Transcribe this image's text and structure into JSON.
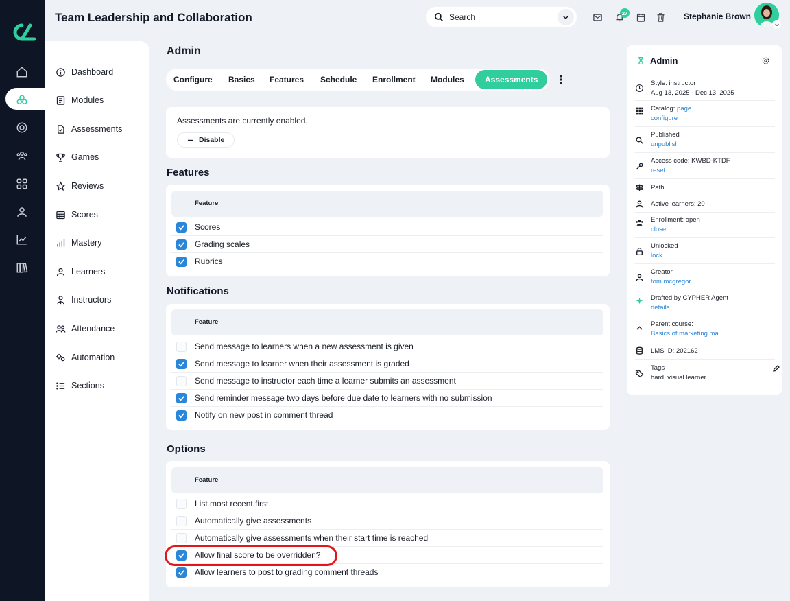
{
  "header": {
    "title": "Team Leadership and Collaboration",
    "search_placeholder": "Search",
    "notifications_count": "27",
    "user_name": "Stephanie Brown"
  },
  "nav": {
    "items": [
      {
        "label": "Dashboard",
        "icon": "info-icon"
      },
      {
        "label": "Modules",
        "icon": "document-icon"
      },
      {
        "label": "Assessments",
        "icon": "checklist-icon"
      },
      {
        "label": "Games",
        "icon": "trophy-icon"
      },
      {
        "label": "Reviews",
        "icon": "star-icon"
      },
      {
        "label": "Scores",
        "icon": "table-icon"
      },
      {
        "label": "Mastery",
        "icon": "bar-chart-icon"
      },
      {
        "label": "Learners",
        "icon": "user-icon"
      },
      {
        "label": "Instructors",
        "icon": "instructor-icon"
      },
      {
        "label": "Attendance",
        "icon": "users-icon"
      },
      {
        "label": "Automation",
        "icon": "gears-icon"
      },
      {
        "label": "Sections",
        "icon": "list-icon"
      }
    ]
  },
  "main": {
    "heading": "Admin",
    "tabs": [
      "Configure",
      "Basics",
      "Features",
      "Schedule",
      "Enrollment",
      "Modules",
      "Assessments"
    ],
    "active_tab": "Assessments",
    "status_text": "Assessments are currently enabled.",
    "disable_label": "Disable",
    "features": {
      "heading": "Features",
      "column": "Feature",
      "rows": [
        {
          "label": "Scores",
          "checked": true
        },
        {
          "label": "Grading scales",
          "checked": true
        },
        {
          "label": "Rubrics",
          "checked": true
        }
      ]
    },
    "notifications": {
      "heading": "Notifications",
      "column": "Feature",
      "rows": [
        {
          "label": "Send message to learners when a new assessment is given",
          "checked": false
        },
        {
          "label": "Send message to learner when their assessment is graded",
          "checked": true
        },
        {
          "label": "Send message to instructor each time a learner submits an assessment",
          "checked": false
        },
        {
          "label": "Send reminder message two days before due date to learners with no submission",
          "checked": true
        },
        {
          "label": "Notify on new post in comment thread",
          "checked": true
        }
      ]
    },
    "options": {
      "heading": "Options",
      "column": "Feature",
      "rows": [
        {
          "label": "List most recent first",
          "checked": false
        },
        {
          "label": "Automatically give assessments",
          "checked": false
        },
        {
          "label": "Automatically give assessments when their start time is reached",
          "checked": false
        },
        {
          "label": "Allow final score to be overridden?",
          "checked": true
        },
        {
          "label": "Allow learners to post to grading comment threads",
          "checked": true
        }
      ]
    }
  },
  "panel": {
    "title": "Admin",
    "style_line": "Style: instructor",
    "date_range": "Aug 13, 2025 - Dec 13, 2025",
    "catalog_label": "Catalog: ",
    "catalog_link": "page",
    "catalog_configure": "configure",
    "published": "Published",
    "unpublish": "unpublish",
    "access_code": "Access code: KWBD-KTDF",
    "reset": "reset",
    "path": "Path",
    "active_learners": "Active learners: 20",
    "enrollment": "Enrollment: open",
    "close": "close",
    "unlocked": "Unlocked",
    "lock": "lock",
    "creator": "Creator",
    "creator_name": "tom mcgregor",
    "drafted": "Drafted by CYPHER Agent",
    "details": "details",
    "parent_course": "Parent course:",
    "parent_course_link": "Basics of marketing ma...",
    "lms_id": "LMS ID: 202162",
    "tags": "Tags",
    "tags_value": "hard, visual learner"
  },
  "colors": {
    "accent": "#2fce9c",
    "link": "#2a86d8",
    "rail": "#0e1524",
    "highlight": "#e3161c"
  }
}
